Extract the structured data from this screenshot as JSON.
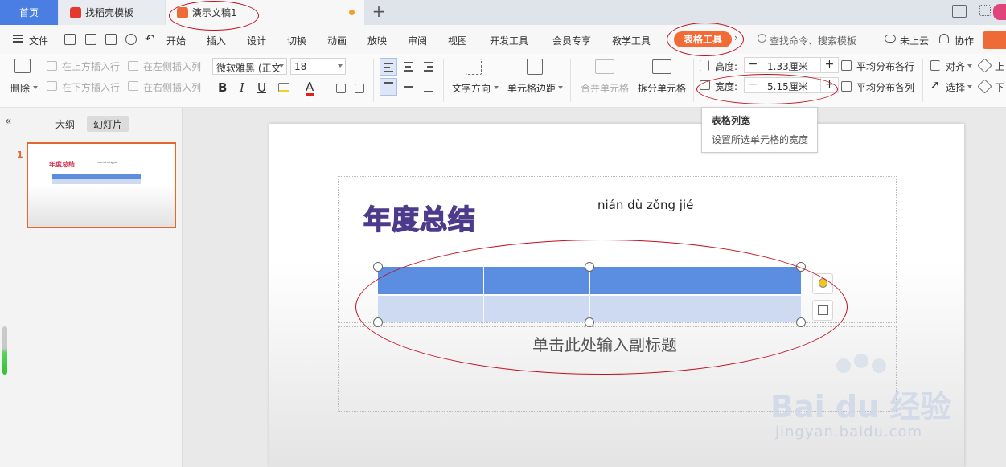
{
  "tabs": {
    "home": "首页",
    "template": "找稻壳模板",
    "document": "演示文稿1"
  },
  "menu": {
    "file": "文件",
    "items": [
      "开始",
      "插入",
      "设计",
      "切换",
      "动画",
      "放映",
      "审阅",
      "视图",
      "开发工具",
      "会员专享",
      "教学工具"
    ],
    "table_tools": "表格工具",
    "search": "查找命令、搜索模板",
    "cloud": "未上云",
    "collab": "协作"
  },
  "ribbon": {
    "delete": "删除",
    "insert_above": "在上方插入行",
    "insert_below": "在下方插入行",
    "insert_left": "在左侧插入列",
    "insert_right": "在右侧插入列",
    "font_name": "微软雅黑 (正文",
    "font_size": "18",
    "text_direction": "文字方向",
    "cell_margin": "单元格边距",
    "merge_cells": "合并单元格",
    "split_cells": "拆分单元格",
    "height_label": "高度:",
    "height_value": "1.33厘米",
    "width_label": "宽度:",
    "width_value": "5.15厘米",
    "distribute_rows": "平均分布各行",
    "distribute_cols": "平均分布各列",
    "align": "对齐",
    "select": "选择",
    "up": "上",
    "down": "下",
    "bold": "B",
    "italic": "I",
    "underline": "U",
    "font_color_letter": "A"
  },
  "tooltip": {
    "title": "表格列宽",
    "desc": "设置所选单元格的宽度"
  },
  "left_panel": {
    "outline": "大纲",
    "slides": "幻灯片",
    "slide_number": "1"
  },
  "slide": {
    "title": "年度总结",
    "pinyin": "nián dù zǒng jié",
    "subtitle": "单击此处输入副标题",
    "table_header_color": "#5b8ee0",
    "table_body_color": "#cddaf2"
  },
  "watermark": {
    "brand": "Bai du 经验",
    "url": "jingyan.baidu.com"
  },
  "colors": {
    "accent_blue": "#4a7ee3",
    "accent_orange": "#f26b36",
    "annotation_red": "#c01020",
    "title_pink": "#e0557f"
  }
}
